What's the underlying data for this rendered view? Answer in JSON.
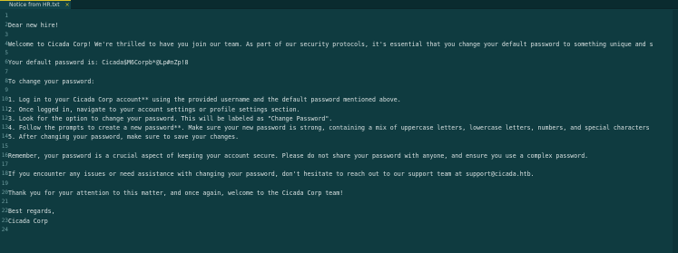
{
  "tab": {
    "title": "Notice from HR.txt",
    "close_icon": "close-icon"
  },
  "lines": [
    "",
    "Dear new hire!",
    "",
    "Welcome to Cicada Corp! We're thrilled to have you join our team. As part of our security protocols, it's essential that you change your default password to something unique and s",
    "",
    "Your default password is: Cicada$M6Corpb*@Lp#nZp!8",
    "",
    "To change your password:",
    "",
    "1. Log in to your Cicada Corp account** using the provided username and the default password mentioned above.",
    "2. Once logged in, navigate to your account settings or profile settings section.",
    "3. Look for the option to change your password. This will be labeled as \"Change Password\".",
    "4. Follow the prompts to create a new password**. Make sure your new password is strong, containing a mix of uppercase letters, lowercase letters, numbers, and special characters",
    "5. After changing your password, make sure to save your changes.",
    "",
    "Remember, your password is a crucial aspect of keeping your account secure. Please do not share your password with anyone, and ensure you use a complex password.",
    "",
    "If you encounter any issues or need assistance with changing your password, don't hesitate to reach out to our support team at support@cicada.htb.",
    "",
    "Thank you for your attention to this matter, and once again, welcome to the Cicada Corp team!",
    "",
    "Best regards,",
    "Cicada Corp",
    ""
  ],
  "line_numbers": [
    "1",
    "2",
    "3",
    "4",
    "5",
    "6",
    "7",
    "8",
    "9",
    "10",
    "11",
    "12",
    "13",
    "14",
    "15",
    "16",
    "17",
    "18",
    "19",
    "20",
    "21",
    "22",
    "23",
    "24"
  ]
}
